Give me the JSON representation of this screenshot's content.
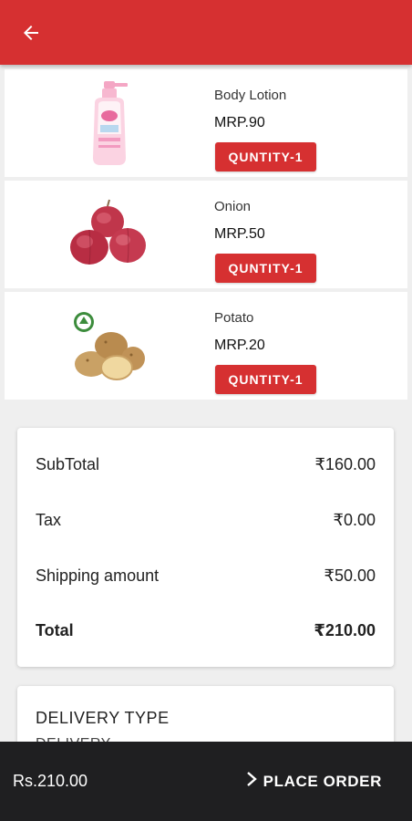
{
  "header": {
    "back_icon": "arrow-left-icon",
    "bg_color": "#d63031"
  },
  "products": [
    {
      "name": "Body Lotion",
      "price": "MRP.90",
      "qty_label": "QUNTITY-1",
      "image_icon": "lotion-bottle-image"
    },
    {
      "name": "Onion",
      "price": "MRP.50",
      "qty_label": "QUNTITY-1",
      "image_icon": "onion-image"
    },
    {
      "name": "Potato",
      "price": "MRP.20",
      "qty_label": "QUNTITY-1",
      "image_icon": "potato-image"
    }
  ],
  "summary": {
    "subtotal_label": "SubTotal",
    "subtotal_value": "₹160.00",
    "tax_label": "Tax",
    "tax_value": "₹0.00",
    "shipping_label": "Shipping amount",
    "shipping_value": "₹50.00",
    "total_label": "Total",
    "total_value": "₹210.00"
  },
  "delivery": {
    "title": "DELIVERY TYPE",
    "value": "DELIVERY"
  },
  "bottom_bar": {
    "total": "Rs.210.00",
    "place_order_label": "PLACE ORDER",
    "chevron_icon": "chevron-right-icon"
  },
  "colors": {
    "accent": "#d63031",
    "bottom_bar": "#1f1f21"
  }
}
